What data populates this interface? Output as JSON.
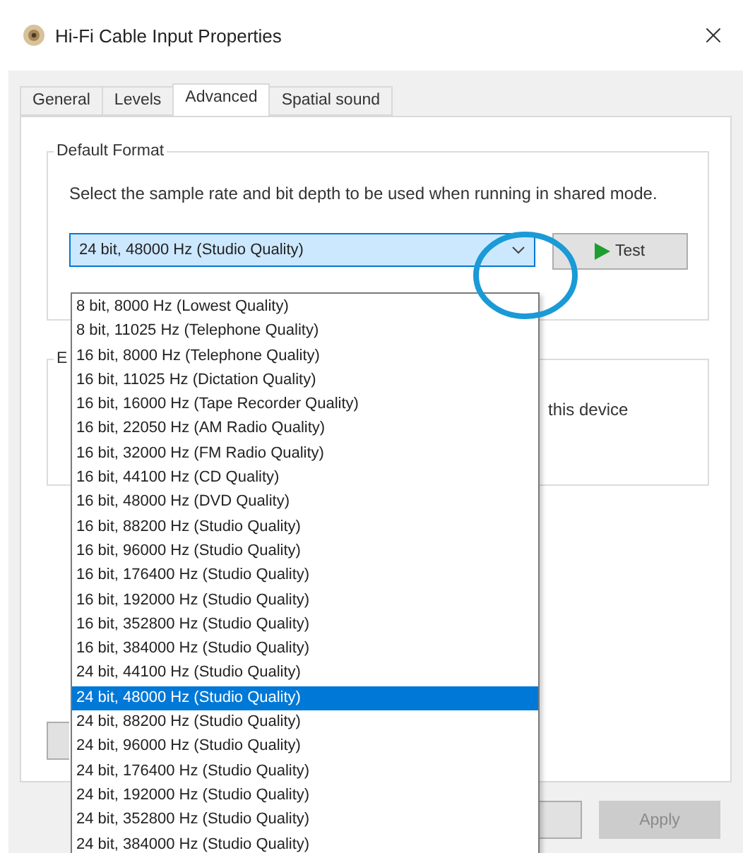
{
  "window": {
    "title": "Hi-Fi Cable Input Properties"
  },
  "tabs": [
    {
      "label": "General",
      "selected": false
    },
    {
      "label": "Levels",
      "selected": false
    },
    {
      "label": "Advanced",
      "selected": true
    },
    {
      "label": "Spatial sound",
      "selected": false
    }
  ],
  "default_format": {
    "legend": "Default Format",
    "description": "Select the sample rate and bit depth to be used when running in shared mode.",
    "value": "24 bit, 48000 Hz (Studio Quality)",
    "expanded": true,
    "test_button": "Test"
  },
  "dropdown_options": [
    {
      "label": "8 bit, 8000 Hz (Lowest Quality)",
      "selected": false
    },
    {
      "label": "8 bit, 11025 Hz (Telephone Quality)",
      "selected": false
    },
    {
      "label": "16 bit, 8000 Hz (Telephone Quality)",
      "selected": false
    },
    {
      "label": "16 bit, 11025 Hz (Dictation Quality)",
      "selected": false
    },
    {
      "label": "16 bit, 16000 Hz (Tape Recorder Quality)",
      "selected": false
    },
    {
      "label": "16 bit, 22050 Hz (AM Radio Quality)",
      "selected": false
    },
    {
      "label": "16 bit, 32000 Hz (FM Radio Quality)",
      "selected": false
    },
    {
      "label": "16 bit, 44100 Hz (CD Quality)",
      "selected": false
    },
    {
      "label": "16 bit, 48000 Hz (DVD Quality)",
      "selected": false
    },
    {
      "label": "16 bit, 88200 Hz (Studio Quality)",
      "selected": false
    },
    {
      "label": "16 bit, 96000 Hz (Studio Quality)",
      "selected": false
    },
    {
      "label": "16 bit, 176400 Hz (Studio Quality)",
      "selected": false
    },
    {
      "label": "16 bit, 192000 Hz (Studio Quality)",
      "selected": false
    },
    {
      "label": "16 bit, 352800 Hz (Studio Quality)",
      "selected": false
    },
    {
      "label": "16 bit, 384000 Hz (Studio Quality)",
      "selected": false
    },
    {
      "label": "24 bit, 44100 Hz (Studio Quality)",
      "selected": false
    },
    {
      "label": "24 bit, 48000 Hz (Studio Quality)",
      "selected": true
    },
    {
      "label": "24 bit, 88200 Hz (Studio Quality)",
      "selected": false
    },
    {
      "label": "24 bit, 96000 Hz (Studio Quality)",
      "selected": false
    },
    {
      "label": "24 bit, 176400 Hz (Studio Quality)",
      "selected": false
    },
    {
      "label": "24 bit, 192000 Hz (Studio Quality)",
      "selected": false
    },
    {
      "label": "24 bit, 352800 Hz (Studio Quality)",
      "selected": false
    },
    {
      "label": "24 bit, 384000 Hz (Studio Quality)",
      "selected": false
    }
  ],
  "exclusive_group": {
    "legend": "E",
    "text": "this device"
  },
  "buttons": [
    {
      "label": "Apply",
      "disabled": true
    }
  ],
  "highlight": {
    "kind": "circle"
  }
}
